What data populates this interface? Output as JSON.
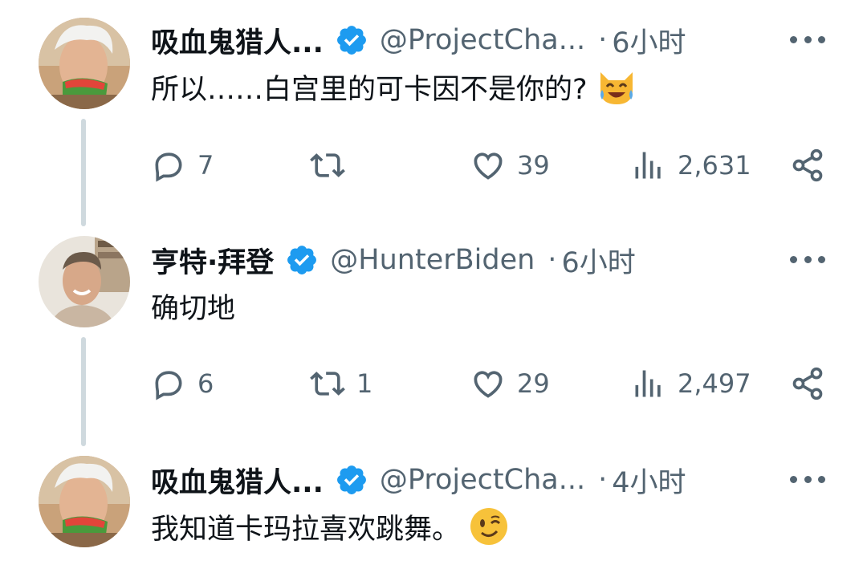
{
  "tweets": [
    {
      "name": "吸血鬼猎人...",
      "handle": "@ProjectCha...",
      "separator": "·",
      "time": "6小时",
      "text": "所以……白宫里的可卡因不是你的?",
      "emoji": "laughing-cat-emoji",
      "replies": "7",
      "retweets": "",
      "likes": "39",
      "views": "2,631"
    },
    {
      "name": "亨特·拜登",
      "handle": "@HunterBiden",
      "separator": "·",
      "time": "6小时",
      "text": "确切地",
      "emoji": "",
      "replies": "6",
      "retweets": "1",
      "likes": "29",
      "views": "2,497"
    },
    {
      "name": "吸血鬼猎人...",
      "handle": "@ProjectCha...",
      "separator": "·",
      "time": "4小时",
      "text": "我知道卡玛拉喜欢跳舞。",
      "emoji": "winking-face-emoji"
    }
  ],
  "colors": {
    "verified": "#1d9bf0",
    "secondary_text": "#536471",
    "thread_line": "#cfd9de"
  }
}
